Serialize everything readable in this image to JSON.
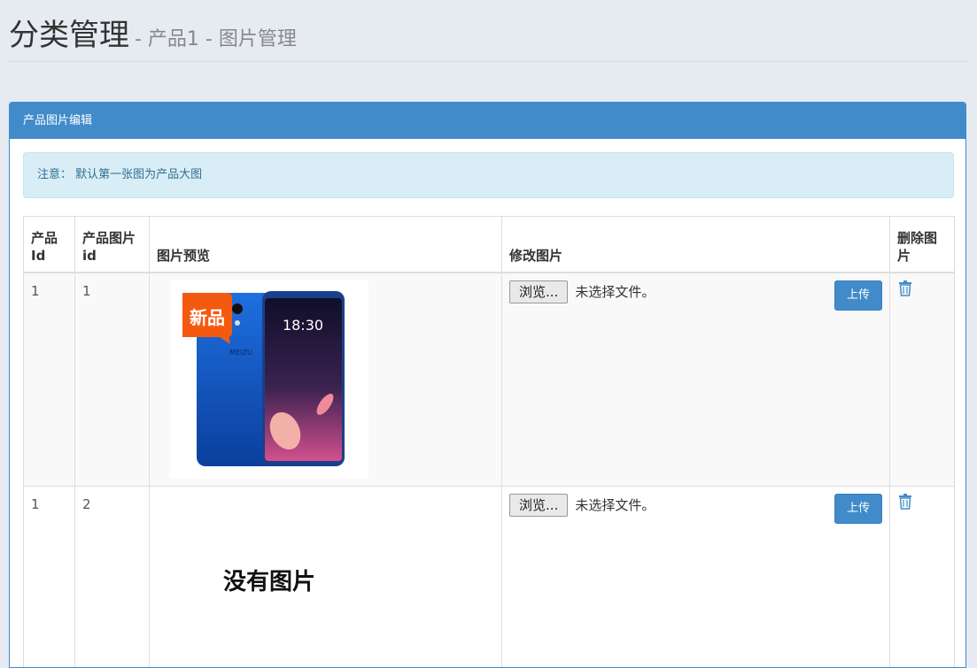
{
  "header": {
    "title": "分类管理",
    "subtitle": "- 产品1 - 图片管理"
  },
  "panel": {
    "title": "产品图片编辑"
  },
  "alert": {
    "text": "注意：   默认第一张图为产品大图"
  },
  "table": {
    "columns": {
      "product_id": "产品Id",
      "image_id": "产品图片id",
      "preview": "图片预览",
      "edit": "修改图片",
      "delete": "删除图片"
    },
    "rows": [
      {
        "product_id": "1",
        "image_id": "1",
        "badge": "新品",
        "phone_time": "18:30",
        "phone_brand": "MEIZU",
        "browse_label": "浏览...",
        "file_status": "未选择文件。",
        "upload_label": "上传"
      },
      {
        "product_id": "1",
        "image_id": "2",
        "no_image_text": "没有图片",
        "browse_label": "浏览...",
        "file_status": "未选择文件。",
        "upload_label": "上传"
      }
    ]
  },
  "colors": {
    "primary": "#428bca",
    "alert_bg": "#d9edf7",
    "alert_text": "#31708f",
    "badge": "#f45a0f"
  },
  "icons": {
    "delete": "trash-icon"
  }
}
